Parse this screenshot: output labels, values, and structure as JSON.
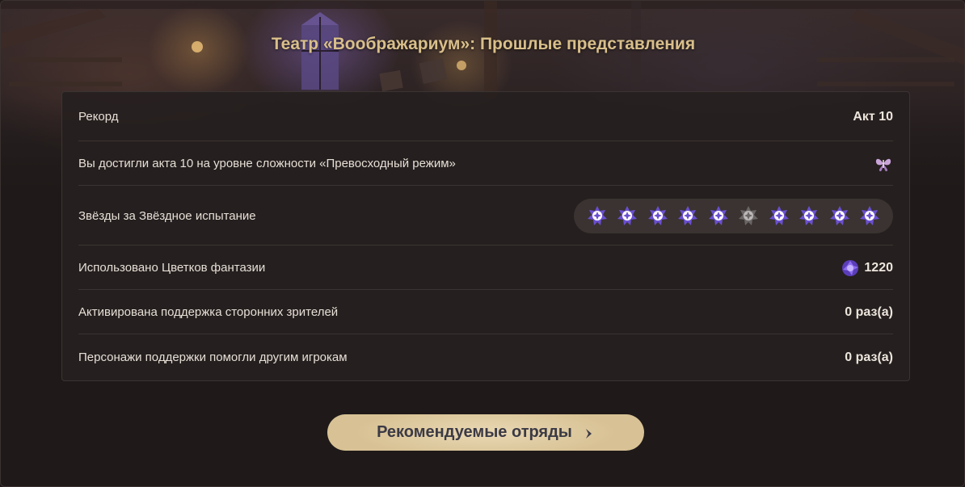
{
  "page": {
    "title": "Театр «Воображариум»: Прошлые представления"
  },
  "stats": [
    {
      "label": "Рекорд",
      "value": "Акт 10"
    },
    {
      "label": "Вы достигли акта 10 на уровне сложности «Превосходный режим»",
      "icon": "butterfly-mode-icon"
    },
    {
      "label": "Звёзды за Звёздное испытание"
    },
    {
      "label": "Использовано Цветков фантазии",
      "value": "1220",
      "icon": "fantasia-flower-icon"
    },
    {
      "label": "Активирована поддержка сторонних зрителей",
      "value": "0 раз(а)"
    },
    {
      "label": "Персонажи поддержки помогли другим игрокам",
      "value": "0 раз(а)"
    }
  ],
  "star_challenge": {
    "earned_pattern": [
      true,
      true,
      true,
      true,
      true,
      false,
      true,
      true,
      true,
      true
    ],
    "colors": {
      "earned": "#6a4fd0",
      "missed": "#6a6666"
    }
  },
  "button": {
    "label": "Рекомендуемые отряды",
    "icon": "chevron-right-icon"
  },
  "colors": {
    "title": "#d9bf8a",
    "button_bg": "#e0cba0",
    "button_text": "#3b3a45"
  }
}
